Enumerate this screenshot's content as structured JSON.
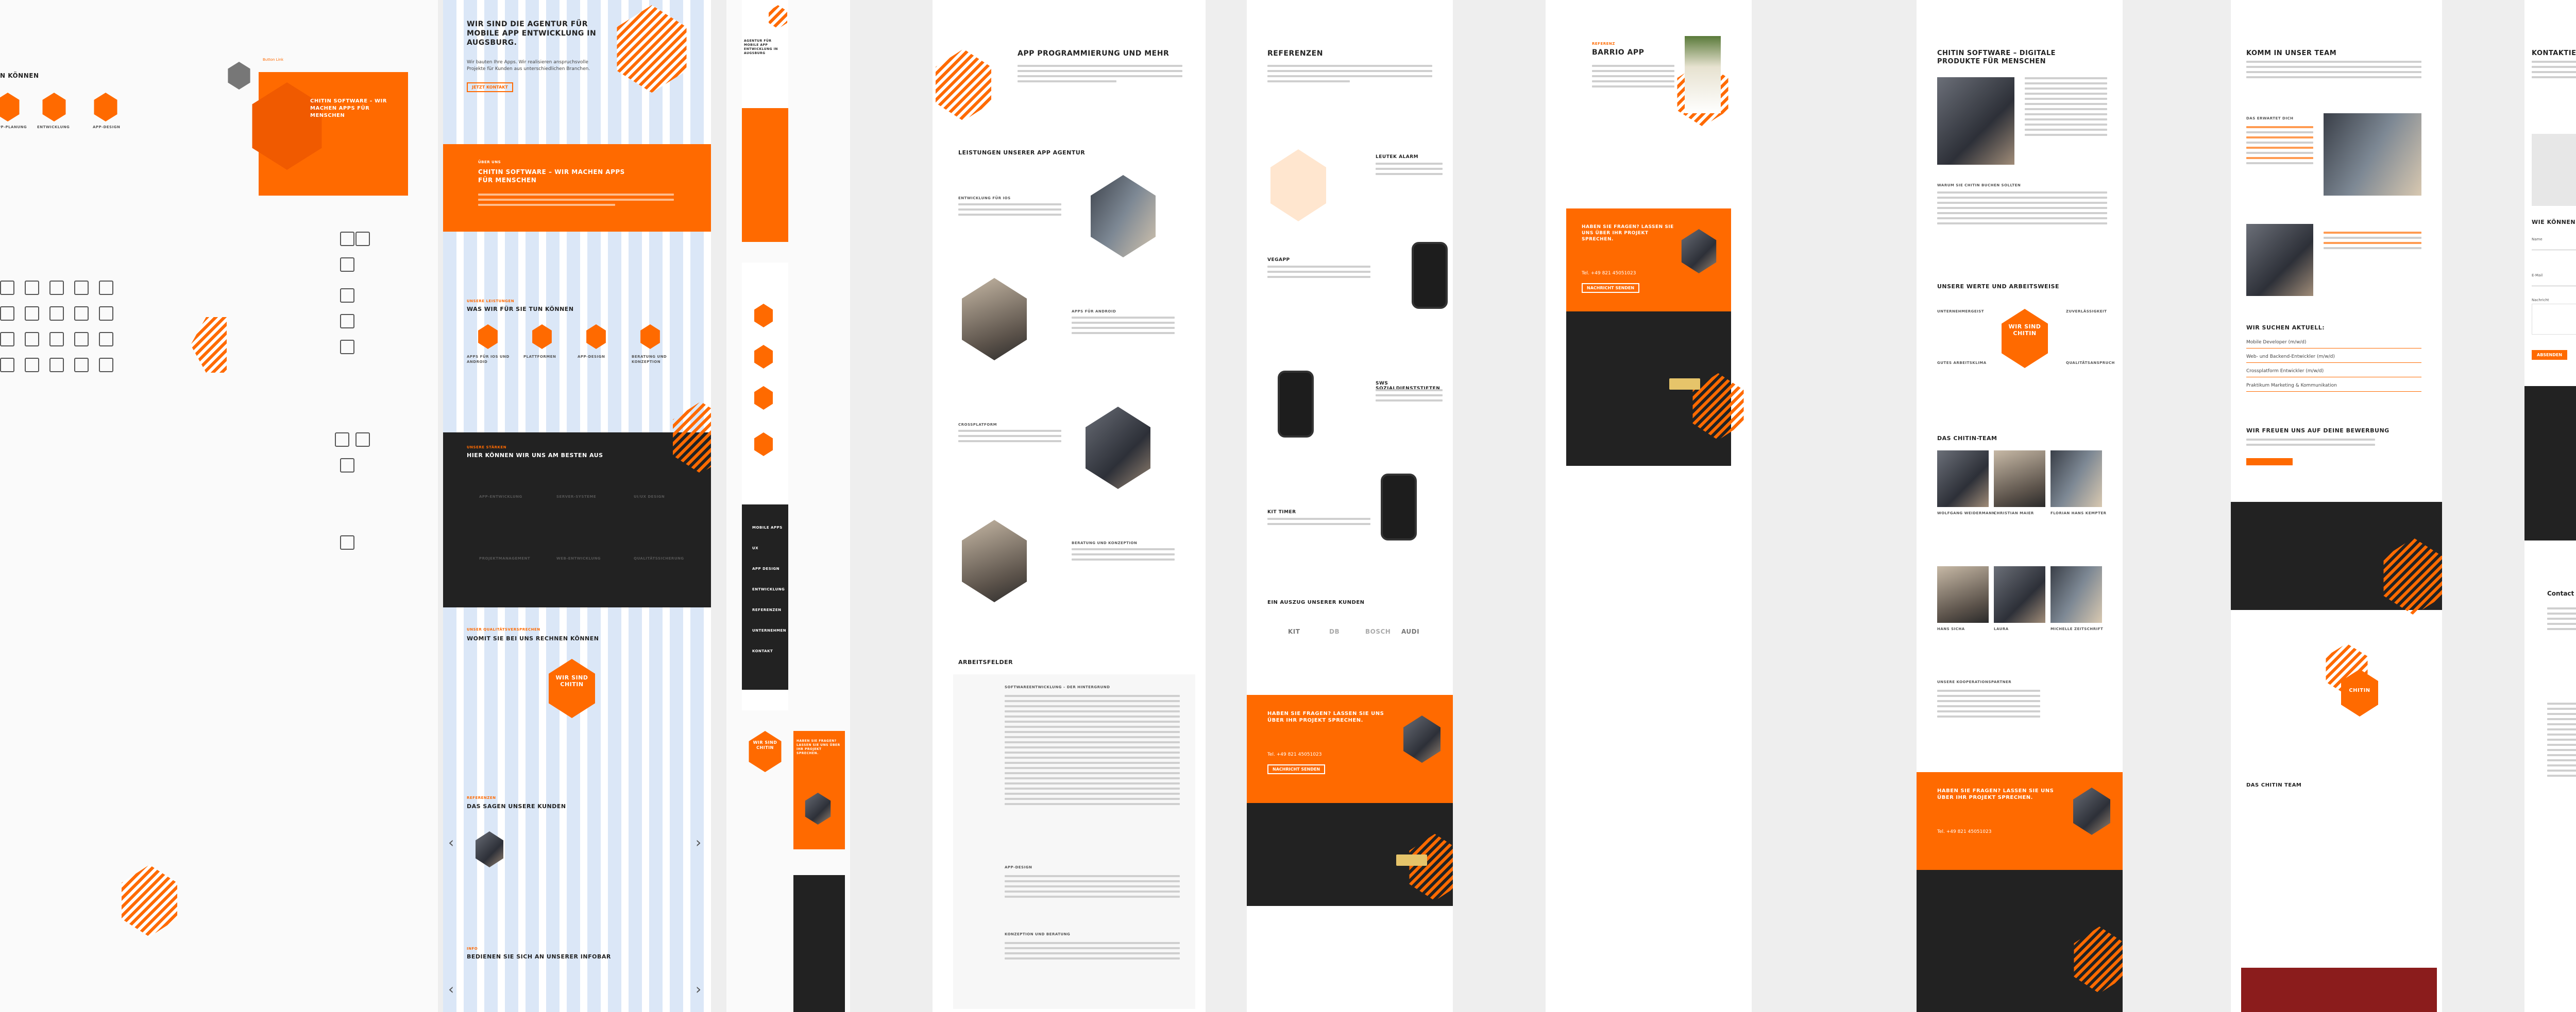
{
  "styleguide": {
    "section_title": "N KÖNNEN",
    "swatch_label": "#222222",
    "tag_label": "Button Link",
    "hero_title": "CHITIN SOFTWARE – WIR MACHEN APPS FÜR MENSCHEN",
    "feature_labels": [
      "APP-PLANUNG",
      "ENTWICKLUNG",
      "APP-DESIGN"
    ]
  },
  "home": {
    "hero_title": "WIR SIND DIE AGENTUR FÜR MOBILE APP ENTWICKLUNG IN AUGSBURG.",
    "hero_subtitle": "Wir bauten Ihre Apps. Wir realisieren anspruchsvolle Projekte für Kunden aus unterschiedlichen Branchen.",
    "hero_button": "Jetzt Kontakt",
    "banner_kicker": "ÜBER UNS",
    "banner_title": "CHITIN SOFTWARE – WIR MACHEN APPS FÜR MENSCHEN",
    "services_kicker": "UNSERE LEISTUNGEN",
    "services_title": "WAS WIR FÜR SIE TUN KÖNNEN",
    "services": [
      "APPS FÜR IOS UND ANDROID",
      "PLATTFORMEN",
      "APP-DESIGN",
      "BERATUNG UND KONZEPTION"
    ],
    "dark_kicker": "UNSERE STÄRKEN",
    "dark_title": "HIER KÖNNEN WIR UNS AM BESTEN AUS",
    "dark_items": [
      "APP-ENTWICKLUNG",
      "SERVER-SYSTEME",
      "UI/UX DESIGN",
      "PROJEKTMANAGEMENT",
      "WEB-ENTWICKLUNG",
      "QUALITÄTSSICHERUNG"
    ],
    "values_kicker": "UNSER QUALITÄTSVERSPRECHEN",
    "values_title": "WOMIT SIE BEI UNS RECHNEN KÖNNEN",
    "logo_text": "WIR SIND CHITIN",
    "testimonial_kicker": "REFERENZEN",
    "testimonial_title": "DAS SAGEN UNSERE KUNDEN",
    "info_kicker": "INFO",
    "info_title": "BEDIENEN SIE SICH AN UNSERER INFOBAR"
  },
  "mobile": {
    "title": "AGENTUR FÜR MOBILE APP ENTWICKLUNG IN AUGSBURG",
    "menu_items": [
      "MOBILE APPS",
      "UX",
      "APP DESIGN",
      "ENTWICKLUNG",
      "REFERENZEN",
      "UNTERNEHMEN",
      "KONTAKT"
    ],
    "cta": "HABEN SIE FRAGEN? LASSEN SIE UNS ÜBER IHR PROJEKT SPRECHEN.",
    "logo_text": "WIR SIND CHITIN"
  },
  "services_page": {
    "title": "APP PROGRAMMIERUNG UND MEHR",
    "leistungen_title": "LEISTUNGEN UNSERER APP AGENTUR",
    "items": [
      "ENTWICKLUNG FÜR IOS",
      "APPS FÜR ANDROID",
      "CROSSPLATFORM",
      "BERATUNG UND KONZEPTION"
    ],
    "arbeitsfelder_title": "ARBEITSFELDER",
    "fields": [
      "SOFTWAREENTWICKLUNG – DER HINTERGRUND",
      "APP-DESIGN",
      "KONZEPTION UND BERATUNG"
    ]
  },
  "referenzen": {
    "title": "REFERENZEN",
    "apps": [
      "LEUTEK ALARM",
      "VEGAPP",
      "SWS SOZIALDIENSTSTIFTEN",
      "KIT TIMER"
    ],
    "clients_title": "EIN AUSZUG UNSERER KUNDEN",
    "client_logos": [
      "KIT",
      "DB",
      "BOSCH",
      "AUDI"
    ],
    "cta_title": "HABEN SIE FRAGEN? LASSEN SIE UNS ÜBER IHR PROJEKT SPRECHEN.",
    "cta_phone": "Tel. +49 821 45051023",
    "cta_button": "Nachricht senden"
  },
  "barrio": {
    "kicker": "REFERENZ",
    "title": "BARRIO APP",
    "cta_title": "HABEN SIE FRAGEN? LASSEN SIE UNS ÜBER IHR PROJEKT SPRECHEN.",
    "cta_phone": "Tel. +49 821 45051023",
    "cta_button": "Nachricht senden"
  },
  "about": {
    "title": "CHITIN SOFTWARE – DIGITALE PRODUKTE FÜR MENSCHEN",
    "why_title": "WARUM SIE CHITIN BUCHEN SOLLTEN",
    "values_title": "UNSERE WERTE UND ARBEITSWEISE",
    "values": [
      "UNTERNEHMERGEIST",
      "ZUVERLÄSSIGKEIT",
      "GUTES ARBEITSKLIMA",
      "QUALITÄTSANSPRUCH"
    ],
    "logo_text": "WIR SIND CHITIN",
    "team_title": "DAS CHITIN-TEAM",
    "team": [
      "Wolfgang Weidermann",
      "Christian Maier",
      "Florian Hans Kempter",
      "Hans Sicha",
      "Laura",
      "Michelle Zeitschrift"
    ],
    "partners_title": "UNSERE KOOPERATIONSPARTNER",
    "cta_title": "HABEN SIE FRAGEN? LASSEN SIE UNS ÜBER IHR PROJEKT SPRECHEN.",
    "cta_phone": "Tel. +49 821 45051023"
  },
  "jobs": {
    "title": "KOMM IN UNSER TEAM",
    "expect_title": "DAS ERWARTET DICH",
    "search_title": "WIR SUCHEN AKTUELL:",
    "positions": [
      "Mobile Developer (m/w/d)",
      "Web- und Backend-Entwickler (m/w/d)",
      "Crossplatform Entwickler (m/w/d)",
      "Praktikum Marketing & Kommunikation"
    ],
    "apply_title": "WIR FREUEN UNS AUF DEINE BEWERBUNG",
    "bottom_title": "DAS CHITIN TEAM",
    "logo_text": "CHITIN"
  },
  "contact": {
    "title": "KONTAKTIEREN SI",
    "help_title": "WIE KÖNNEN WIR SIE",
    "form_labels": [
      "Name",
      "E-Mail",
      "Nachricht"
    ],
    "contact_heading": "Contact – Get in tou",
    "submit_label": "Absenden"
  },
  "colors": {
    "accent": "#ff6a00",
    "dark": "#222222",
    "light": "#ffffff",
    "stripe_blue": "#dbe7f7"
  }
}
